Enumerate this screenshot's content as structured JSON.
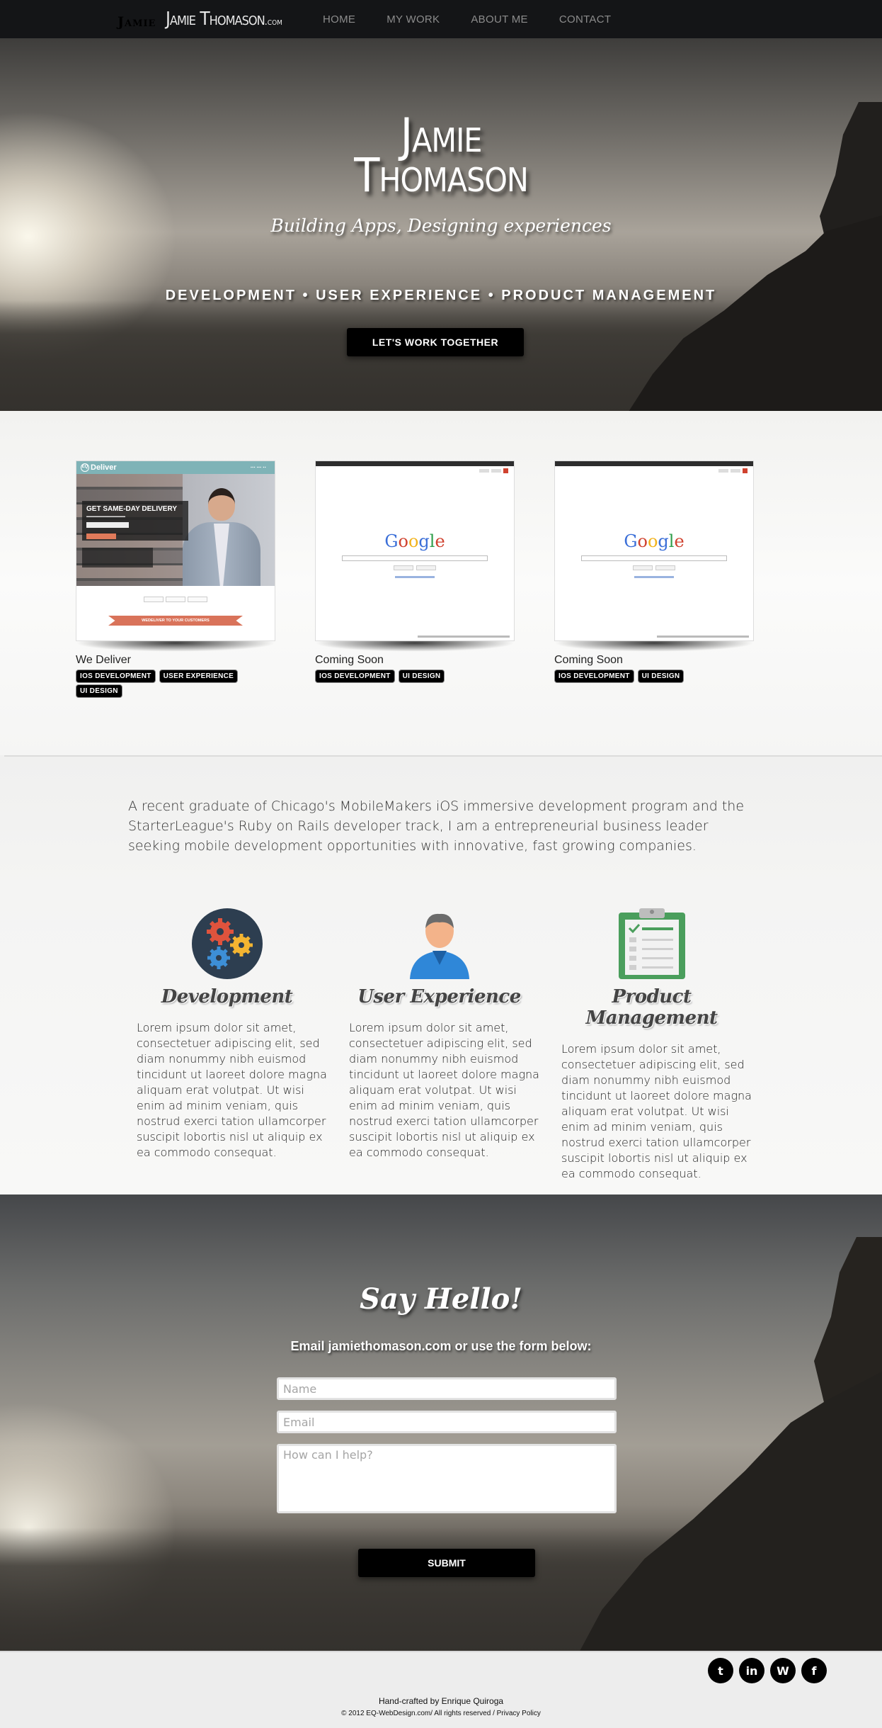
{
  "nav": {
    "logo_shadow": "Jamie",
    "logo_main": "Jamie Thomason",
    "logo_domain": ".com",
    "links": [
      "HOME",
      "MY WORK",
      "ABOUT ME",
      "CONTACT"
    ]
  },
  "hero": {
    "title_line1": "Jamie",
    "title_line2": "Thomason",
    "subtitle": "Building Apps, Designing experiences",
    "tagline": "Development • User Experience • Product Management",
    "cta": "LET'S WORK TOGETHER"
  },
  "portfolio": {
    "items": [
      {
        "title": "We Deliver",
        "tags": [
          "IOS DEVELOPMENT",
          "USER EXPERIENCE",
          "UI DESIGN"
        ],
        "thumb": {
          "logo": "Deliver",
          "headline": "GET SAME-DAY DELIVERY",
          "ribbon": "WEDELIVER TO YOUR CUSTOMERS"
        }
      },
      {
        "title": "Coming Soon",
        "tags": [
          "IOS DEVELOPMENT",
          "UI DESIGN"
        ],
        "thumb": {
          "logo": "Google"
        }
      },
      {
        "title": "Coming Soon",
        "tags": [
          "IOS DEVELOPMENT",
          "UI DESIGN"
        ],
        "thumb": {
          "logo": "Google"
        }
      }
    ]
  },
  "about": {
    "intro": "A recent graduate of Chicago's MobileMakers iOS immersive development program and the StarterLeague's Ruby on Rails developer track, I am a entrepreneurial business leader seeking mobile development opportunities with innovative, fast growing companies.",
    "features": [
      {
        "title": "Development",
        "icon": "gears-icon",
        "text": "Lorem ipsum dolor sit amet, consectetuer adipiscing elit, sed diam nonummy nibh euismod tincidunt ut laoreet dolore magna aliquam erat volutpat. Ut wisi enim ad minim veniam, quis nostrud exerci tation ullamcorper suscipit lobortis nisl ut aliquip ex ea commodo consequat."
      },
      {
        "title": "User Experience",
        "icon": "user-icon",
        "text": "Lorem ipsum dolor sit amet, consectetuer adipiscing elit, sed diam nonummy nibh euismod tincidunt ut laoreet dolore magna aliquam erat volutpat. Ut wisi enim ad minim veniam, quis nostrud exerci tation ullamcorper suscipit lobortis nisl ut aliquip ex ea commodo consequat."
      },
      {
        "title": "Product Management",
        "icon": "clipboard-icon",
        "text": "Lorem ipsum dolor sit amet, consectetuer adipiscing elit, sed diam nonummy nibh euismod tincidunt ut laoreet dolore magna aliquam erat volutpat. Ut wisi enim ad minim veniam, quis nostrud exerci tation ullamcorper suscipit lobortis nisl ut aliquip ex ea commodo consequat."
      }
    ]
  },
  "contact": {
    "title": "Say Hello!",
    "subtitle": "Email jamiethomason.com or use the form below:",
    "name_placeholder": "Name",
    "email_placeholder": "Email",
    "message_placeholder": "How can I help?",
    "submit": "SUBMIT"
  },
  "footer": {
    "socials": [
      "twitter-icon",
      "linkedin-icon",
      "wordpress-icon",
      "facebook-icon"
    ],
    "social_glyphs": [
      "t",
      "in",
      "W",
      "f"
    ],
    "credit": "Hand-crafted by Enrique Quiroga",
    "copyright": "© 2012 EQ-WebDesign.com/ All rights reserved / Privacy Policy"
  },
  "colors": {
    "nav_bg": "#141517",
    "button_bg": "#000000",
    "tag_bg": "#000000",
    "gear_red": "#e0533d",
    "gear_blue": "#3d8fd6",
    "gear_yellow": "#f4b531",
    "icon_dark": "#2d3e50",
    "clipboard_green": "#4a9e5c"
  }
}
